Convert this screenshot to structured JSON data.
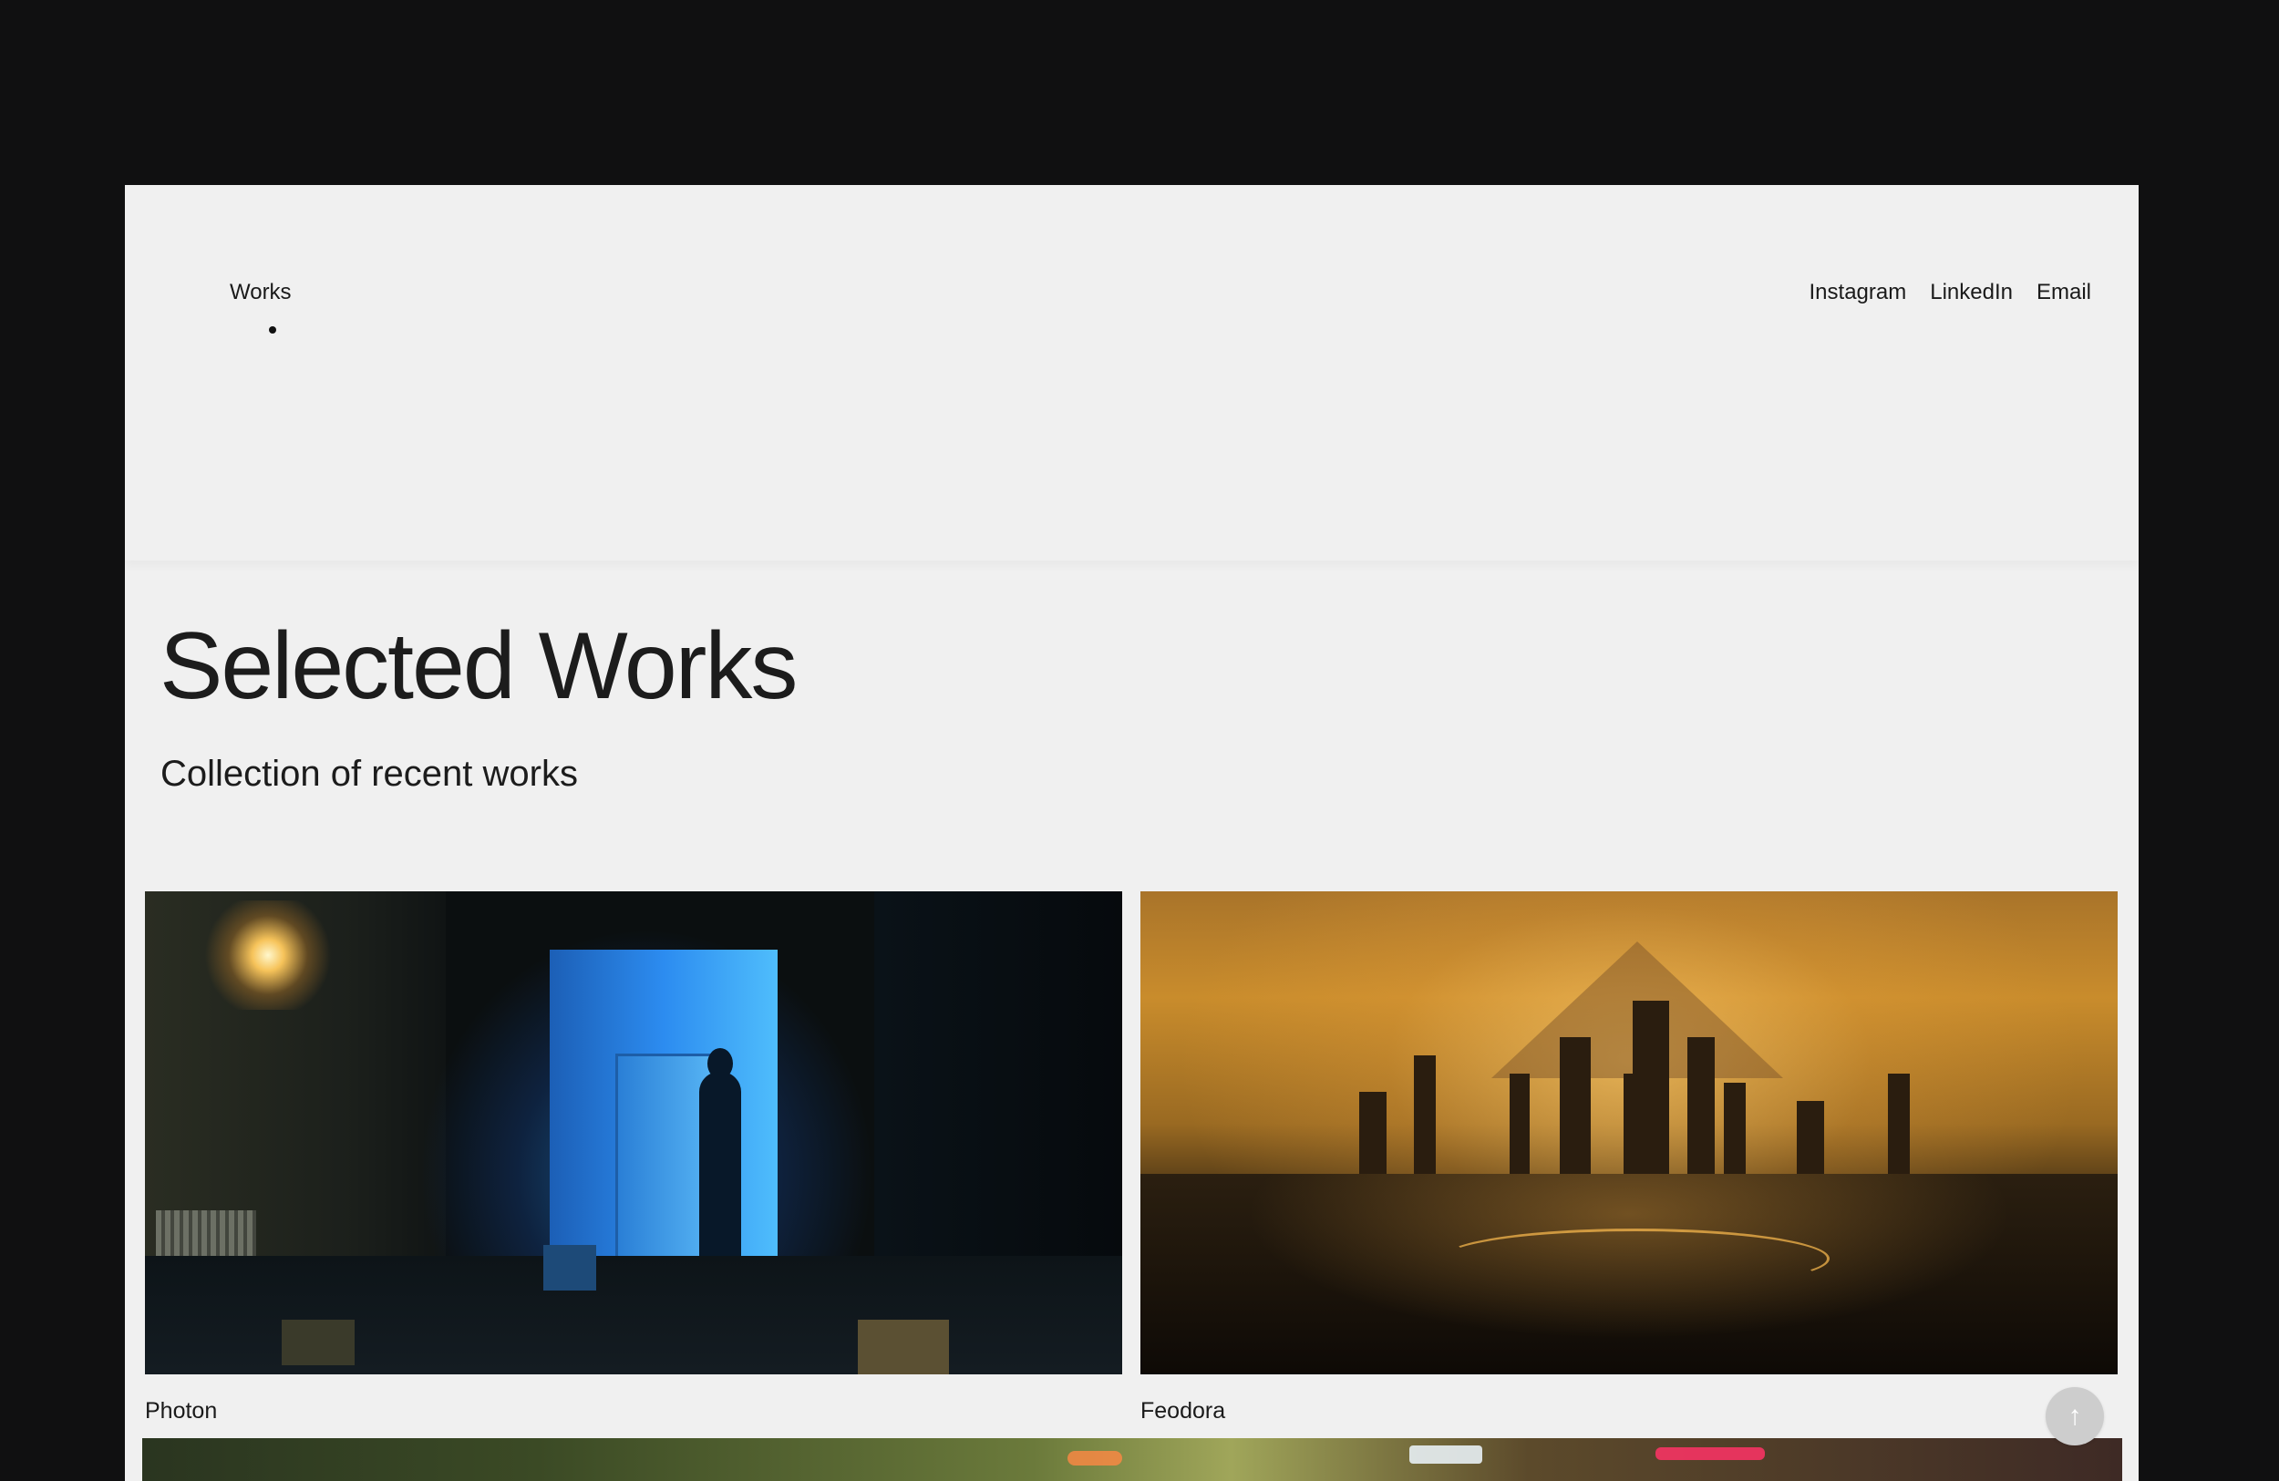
{
  "nav": {
    "works_label": "Works",
    "links": [
      {
        "label": "Instagram"
      },
      {
        "label": "LinkedIn"
      },
      {
        "label": "Email"
      }
    ]
  },
  "hero": {
    "title": "Selected Works",
    "subtitle": "Collection of recent works"
  },
  "works": [
    {
      "title": "Photon"
    },
    {
      "title": "Feodora"
    }
  ],
  "scroll_top": {
    "icon": "arrow-up-icon",
    "glyph": "↑"
  },
  "colors": {
    "background": "#101011",
    "page": "#f0f0f0",
    "text": "#1c1c1c"
  }
}
